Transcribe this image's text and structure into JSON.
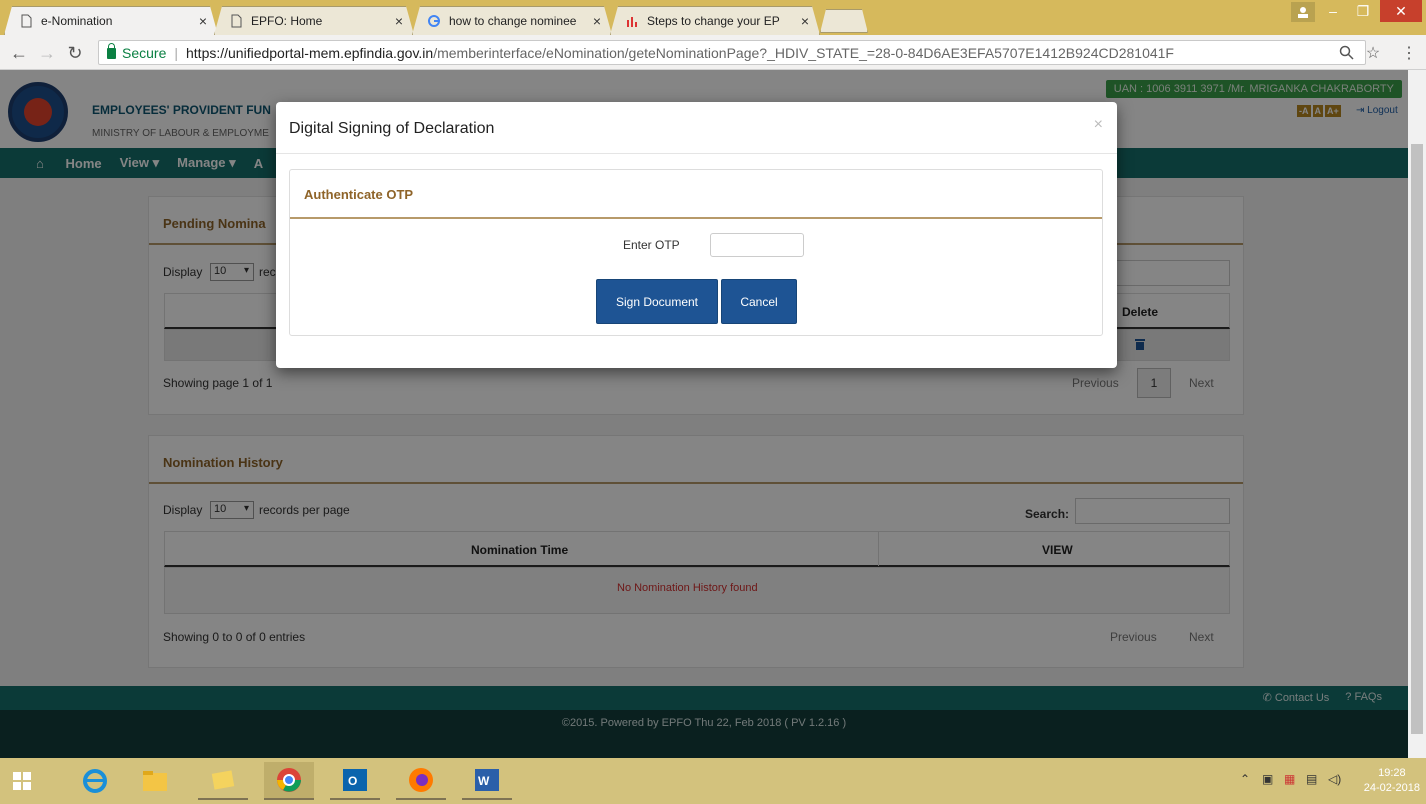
{
  "browser": {
    "tabs": [
      {
        "title": "e-Nomination",
        "active": true
      },
      {
        "title": "EPFO: Home",
        "active": false
      },
      {
        "title": "how to change nominee",
        "active": false
      },
      {
        "title": "Steps to change your EP",
        "active": false
      }
    ],
    "secure_label": "Secure",
    "url_host": "https://unifiedportal-mem.epfindia.gov.in",
    "url_path": "/memberinterface/eNomination/geteNominationPage?_HDIV_STATE_=28-0-84D6AE3EFA5707E1412B924CD281041F"
  },
  "header": {
    "org_name": "EMPLOYEES' PROVIDENT FUN",
    "ministry": "MINISTRY OF LABOUR & EMPLOYME",
    "uan": "UAN : 1006 3911 3971 /Mr. MRIGANKA CHAKRABORTY",
    "font_buttons": [
      "-A",
      "A",
      "A+"
    ],
    "logout": "Logout"
  },
  "nav": {
    "home": "Home",
    "view": "View ▾",
    "manage": "Manage ▾",
    "account": "A"
  },
  "pending": {
    "title": "Pending Nomina",
    "display_prefix": "Display",
    "display_value": "10",
    "display_suffix": "rec",
    "col_delete": "Delete",
    "showing": "Showing page 1 of 1",
    "previous": "Previous",
    "page": "1",
    "next": "Next"
  },
  "history": {
    "title": "Nomination History",
    "display_prefix": "Display",
    "display_value": "10",
    "display_suffix": "records per page",
    "search_label": "Search:",
    "col_time": "Nomination Time",
    "col_view": "VIEW",
    "empty": "No Nomination History found",
    "showing": "Showing 0 to 0 of 0 entries",
    "previous": "Previous",
    "next": "Next"
  },
  "footer": {
    "contact": "Contact Us",
    "faqs": "FAQs",
    "copyright": "©2015. Powered by EPFO Thu 22, Feb 2018 ( PV 1.2.16 )"
  },
  "modal": {
    "title": "Digital Signing of Declaration",
    "close": "×",
    "section_title": "Authenticate OTP",
    "otp_label": "Enter OTP",
    "otp_value": "",
    "sign_button": "Sign Document",
    "cancel_button": "Cancel"
  },
  "taskbar": {
    "time": "19:28",
    "date": "24-02-2018"
  },
  "colors": {
    "teal": "#16706c",
    "brown": "#8f6429",
    "button_blue": "#1e5494",
    "tab_strip": "#d6b95c"
  }
}
